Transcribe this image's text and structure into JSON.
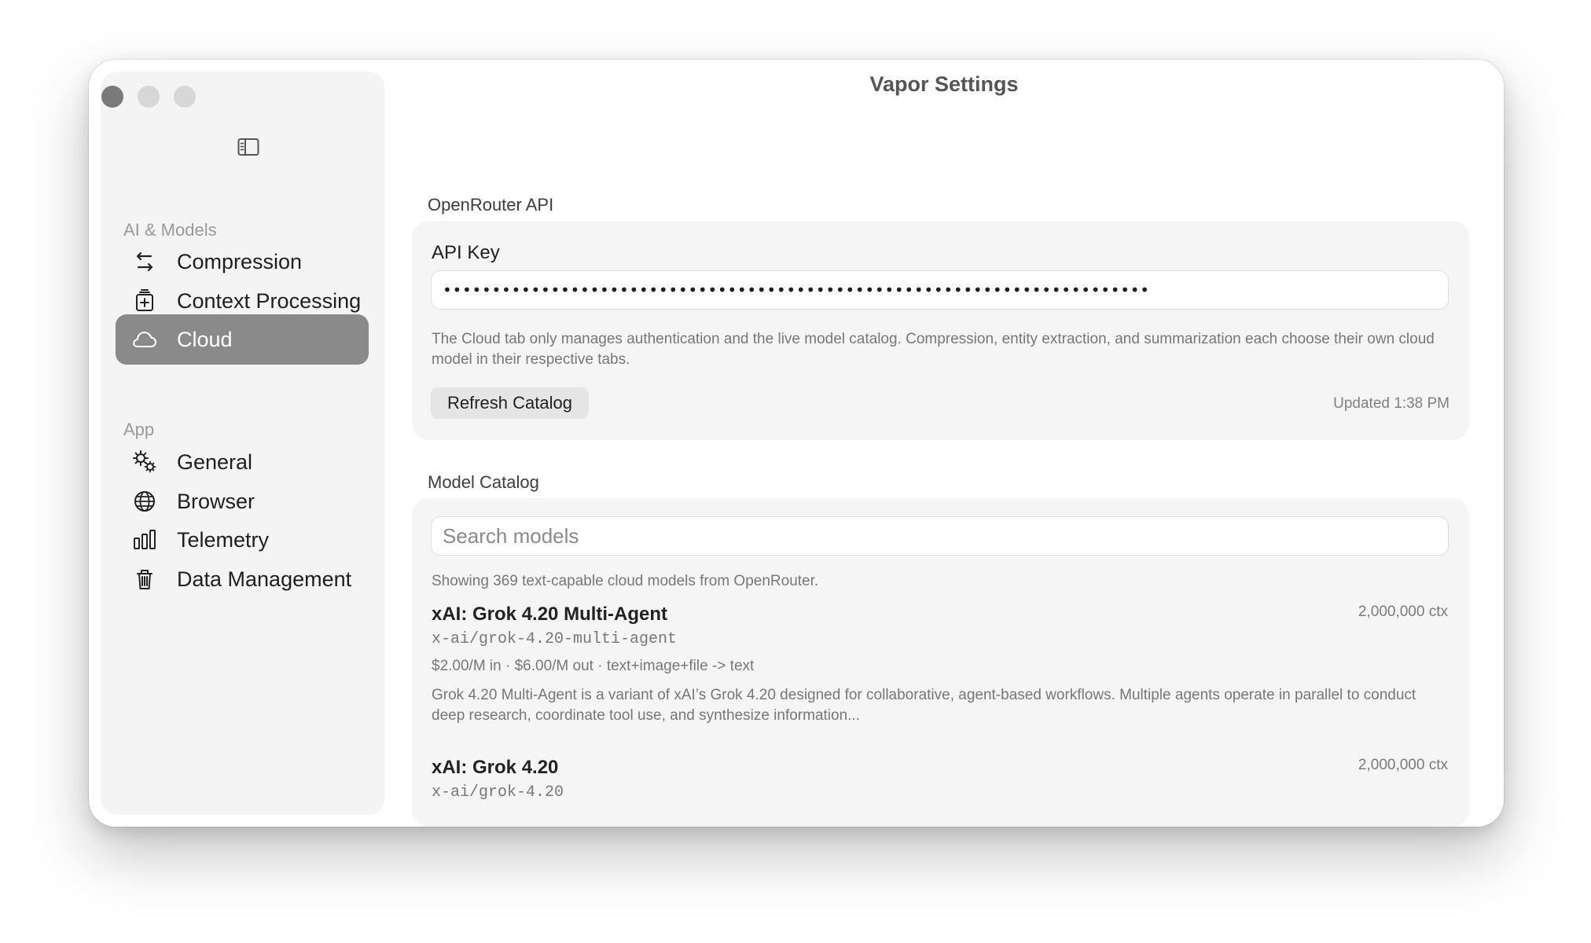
{
  "window": {
    "title": "Vapor Settings"
  },
  "sidebar": {
    "sections": [
      {
        "heading": "AI & Models",
        "items": [
          {
            "label": "Compression",
            "icon": "compression-arrows-icon",
            "active": false
          },
          {
            "label": "Context Processing",
            "icon": "context-processing-icon",
            "active": false
          },
          {
            "label": "Cloud",
            "icon": "cloud-icon",
            "active": true
          }
        ]
      },
      {
        "heading": "App",
        "items": [
          {
            "label": "General",
            "icon": "gears-icon",
            "active": false
          },
          {
            "label": "Browser",
            "icon": "globe-icon",
            "active": false
          },
          {
            "label": "Telemetry",
            "icon": "bar-chart-icon",
            "active": false
          },
          {
            "label": "Data Management",
            "icon": "trash-icon",
            "active": false
          }
        ]
      }
    ],
    "toggle_icon": "sidebar-toggle-icon"
  },
  "openrouter": {
    "section_label": "OpenRouter API",
    "api_key_label": "API Key",
    "api_key_value": "••••••••••••••••••••••••••••••••••••••••••••••••••••••••••••••••••••••••",
    "help_text": "The Cloud tab only manages authentication and the live model catalog. Compression, entity extraction, and summarization each choose their own cloud model in their respective tabs.",
    "refresh_label": "Refresh Catalog",
    "updated_text": "Updated 1:38 PM"
  },
  "catalog": {
    "section_label": "Model Catalog",
    "search_placeholder": "Search models",
    "summary": "Showing 369 text-capable cloud models from OpenRouter.",
    "models": [
      {
        "name": "xAI: Grok 4.20 Multi-Agent",
        "context": "2,000,000 ctx",
        "id": "x-ai/grok-4.20-multi-agent",
        "pricing": "$2.00/M in · $6.00/M out · text+image+file -> text",
        "description": "Grok 4.20 Multi-Agent is a variant of xAI’s Grok 4.20 designed for collaborative, agent-based workflows. Multiple agents operate in parallel to conduct deep research, coordinate tool use, and synthesize information..."
      },
      {
        "name": "xAI: Grok 4.20",
        "context": "2,000,000 ctx",
        "id": "x-ai/grok-4.20"
      }
    ]
  },
  "colors": {
    "active_sidebar": "#8a8a8a",
    "card_background": "#f5f5f5",
    "secondary_text": "#777777"
  }
}
